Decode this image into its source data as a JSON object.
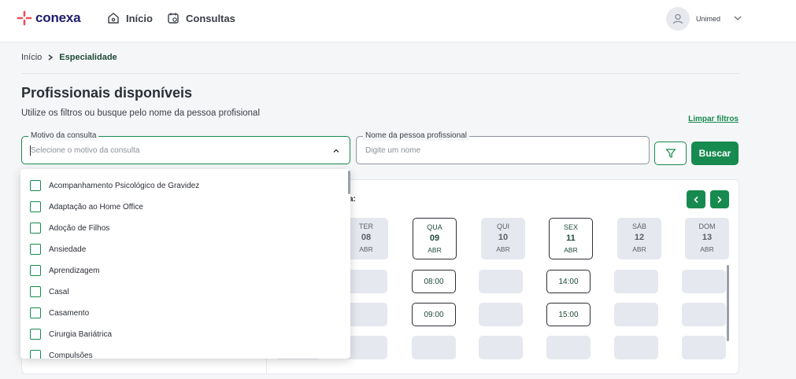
{
  "brand": {
    "name": "conexa",
    "accent": "#178a4f",
    "logo_color": "#1f1d6b",
    "mark_color": "#f04e5c"
  },
  "nav": [
    {
      "label": "Início",
      "icon": "home-icon"
    },
    {
      "label": "Consultas",
      "icon": "calendar-icon"
    }
  ],
  "user": {
    "name": "Unimed",
    "icon": "user-icon"
  },
  "breadcrumb": {
    "home": "Início",
    "current": "Especialidade"
  },
  "page": {
    "title": "Profissionais disponíveis",
    "subtitle": "Utilize os filtros ou busque pelo nome da pessoa profisional",
    "clear_filters": "Limpar filtros"
  },
  "filters": {
    "reason": {
      "label": "Motivo da consulta",
      "placeholder": "Selecione o motivo da consulta"
    },
    "name": {
      "label": "Nome da pessoa profissional",
      "placeholder": "Digite um nome"
    },
    "filter_icon": "filter-icon",
    "search_label": "Buscar"
  },
  "schedule": {
    "week_label": "a:",
    "days": [
      {
        "name": "TER",
        "num": "08",
        "month": "ABR",
        "active": false
      },
      {
        "name": "QUA",
        "num": "09",
        "month": "ABR",
        "active": true
      },
      {
        "name": "QUI",
        "num": "10",
        "month": "ABR",
        "active": false
      },
      {
        "name": "SEX",
        "num": "11",
        "month": "ABR",
        "active": true
      },
      {
        "name": "SÁB",
        "num": "12",
        "month": "ABR",
        "active": false
      },
      {
        "name": "DOM",
        "num": "13",
        "month": "ABR",
        "active": false
      }
    ],
    "times": {
      "qua_1": "08:00",
      "qua_2": "09:00",
      "sex_1": "14:00",
      "sex_2": "15:00"
    }
  },
  "dropdown": {
    "items": [
      "Acompanhamento Psicológico de Gravidez",
      "Adaptação ao Home Office",
      "Adoção de Filhos",
      "Ansiedade",
      "Aprendizagem",
      "Casal",
      "Casamento",
      "Cirurgia Bariátrica",
      "Compulsões"
    ]
  }
}
